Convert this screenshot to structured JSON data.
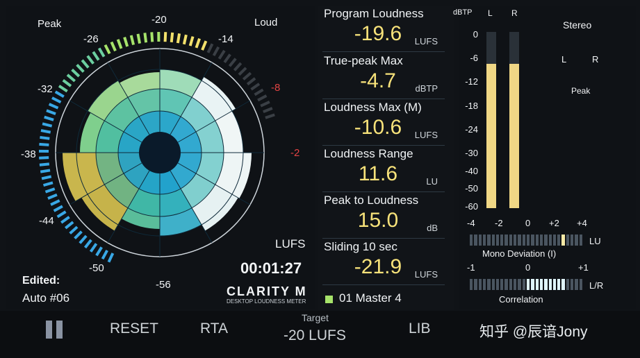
{
  "circular_meter": {
    "peak_label": "Peak",
    "loud_label": "Loud",
    "scale_ticks": [
      "-20",
      "-26",
      "-14",
      "-32",
      "-8",
      "-38",
      "-2",
      "-44",
      "-50",
      "-56"
    ],
    "unit": "LUFS",
    "time": "00:01:27",
    "edited_label": "Edited:",
    "preset": "Auto #06"
  },
  "brand": {
    "logo_text": "CLARITY M",
    "logo_subtitle": "DESKTOP LOUDNESS METER"
  },
  "readouts": [
    {
      "title": "Program Loudness",
      "value": "-19.6",
      "unit": "LUFS"
    },
    {
      "title": "True-peak Max",
      "value": "-4.7",
      "unit": "dBTP"
    },
    {
      "title": "Loudness Max (M)",
      "value": "-10.6",
      "unit": "LUFS"
    },
    {
      "title": "Loudness Range",
      "value": "11.6",
      "unit": "LU"
    },
    {
      "title": "Peak to Loudness",
      "value": "15.0",
      "unit": "dB"
    },
    {
      "title": "Sliding 10 sec",
      "value": "-21.9",
      "unit": "LUFS"
    }
  ],
  "preset_slot": "01 Master 4",
  "peak_meter": {
    "scale_label": "dBTP",
    "channel_l": "L",
    "channel_r": "R",
    "ticks": [
      "0",
      "-6",
      "-12",
      "-18",
      "-24",
      "-30",
      "-40",
      "-50",
      "-60"
    ],
    "level_l_fraction": 0.82,
    "level_r_fraction": 0.82
  },
  "stereo": {
    "title": "Stereo",
    "l": "L",
    "r": "R",
    "peak": "Peak"
  },
  "mono_deviation": {
    "ticks": [
      "-4",
      "-2",
      "0",
      "+2",
      "+4"
    ],
    "unit": "LU",
    "label": "Mono Deviation (I)"
  },
  "correlation": {
    "ticks": [
      "-1",
      "0",
      "+1"
    ],
    "unit": "L/R",
    "label": "Correlation"
  },
  "bottom_bar": {
    "reset": "RESET",
    "rta": "RTA",
    "target_label": "Target",
    "target_value": "-20 LUFS",
    "lib": "LIB",
    "watermark": "知乎 @辰谙Jony"
  },
  "colors": {
    "readout_value": "#f7e27a",
    "meter_fill": "#f0d785",
    "accent_green": "#a6e36a",
    "accent_blue": "#39a8e6"
  }
}
